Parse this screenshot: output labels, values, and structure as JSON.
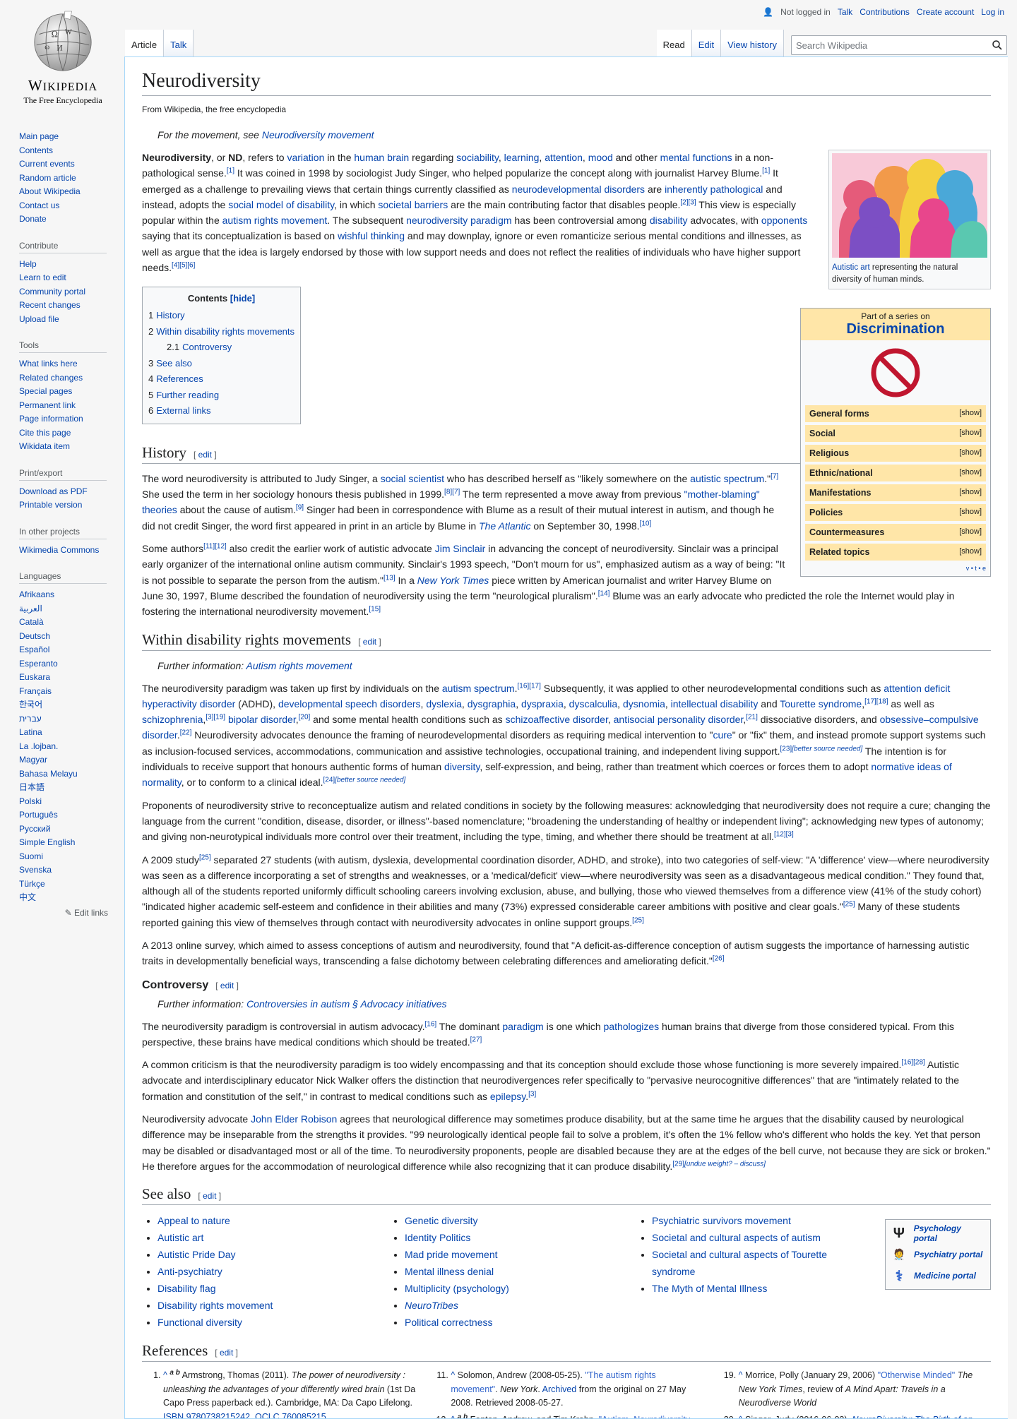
{
  "logo": {
    "wordmark": "Wikipedia",
    "tagline": "The Free Encyclopedia"
  },
  "sidebar": {
    "nav": [
      "Main page",
      "Contents",
      "Current events",
      "Random article",
      "About Wikipedia",
      "Contact us",
      "Donate"
    ],
    "contribute_title": "Contribute",
    "contribute": [
      "Help",
      "Learn to edit",
      "Community portal",
      "Recent changes",
      "Upload file"
    ],
    "tools_title": "Tools",
    "tools": [
      "What links here",
      "Related changes",
      "Special pages",
      "Permanent link",
      "Page information",
      "Cite this page",
      "Wikidata item"
    ],
    "print_title": "Print/export",
    "print": [
      "Download as PDF",
      "Printable version"
    ],
    "projects_title": "In other projects",
    "projects": [
      "Wikimedia Commons"
    ],
    "languages_title": "Languages",
    "languages": [
      "Afrikaans",
      "العربية",
      "Català",
      "Deutsch",
      "Español",
      "Esperanto",
      "Euskara",
      "Français",
      "한국어",
      "עברית",
      "Latina",
      "La .lojban.",
      "Magyar",
      "Bahasa Melayu",
      "日本語",
      "Polski",
      "Português",
      "Русский",
      "Simple English",
      "Suomi",
      "Svenska",
      "Türkçe",
      "中文"
    ],
    "edit_links": "Edit links"
  },
  "personal": {
    "not_logged": "Not logged in",
    "talk": "Talk",
    "contributions": "Contributions",
    "create": "Create account",
    "login": "Log in"
  },
  "tabs": {
    "article": "Article",
    "talk": "Talk",
    "read": "Read",
    "edit": "Edit",
    "history": "View history",
    "search_placeholder": "Search Wikipedia"
  },
  "article": {
    "title": "Neurodiversity",
    "site_sub": "From Wikipedia, the free encyclopedia",
    "hatnote_prefix": "For the movement, see ",
    "hatnote_link": "Neurodiversity movement",
    "thumb_caption_link": "Autistic art",
    "thumb_caption_rest": " representing the natural diversity of human minds.",
    "intro_1": "Neurodiversity",
    "intro_2": ", or ",
    "intro_3": "ND",
    "sidebox": {
      "pretitle": "Part of a series on",
      "title": "Discrimination",
      "rows": [
        "General forms",
        "Social",
        "Religious",
        "Ethnic/national",
        "Manifestations",
        "Policies",
        "Countermeasures",
        "Related topics"
      ],
      "show": "[show]",
      "vte": "v • t • e"
    },
    "toc": {
      "title": "Contents",
      "hide": "[hide]",
      "items": [
        {
          "num": "1",
          "label": "History"
        },
        {
          "num": "2",
          "label": "Within disability rights movements"
        },
        {
          "num": "2.1",
          "label": "Controversy"
        },
        {
          "num": "3",
          "label": "See also"
        },
        {
          "num": "4",
          "label": "References"
        },
        {
          "num": "5",
          "label": "Further reading"
        },
        {
          "num": "6",
          "label": "External links"
        }
      ]
    },
    "h_history": "History",
    "h_within": "Within disability rights movements",
    "within_hatnote_prefix": "Further information: ",
    "within_hatnote_link": "Autism rights movement",
    "h_controversy": "Controversy",
    "controversy_hatnote_link": "Controversies in autism § Advocacy initiatives",
    "h_seealso": "See also",
    "h_references": "References",
    "edit": "edit"
  },
  "see_also": {
    "col1": [
      "Appeal to nature",
      "Autistic art",
      "Autistic Pride Day",
      "Anti-psychiatry",
      "Disability flag",
      "Disability rights movement",
      "Functional diversity"
    ],
    "col2": [
      "Genetic diversity",
      "Identity Politics",
      "Mad pride movement",
      "Mental illness denial",
      "Multiplicity (psychology)",
      "NeuroTribes",
      "Political correctness"
    ],
    "col3": [
      "Psychiatric survivors movement",
      "Societal and cultural aspects of autism",
      "Societal and cultural aspects of Tourette syndrome",
      "The Myth of Mental Illness"
    ],
    "portals": [
      "Psychology portal",
      "Psychiatry portal",
      "Medicine portal"
    ]
  },
  "colors": {
    "link": "#0645ad",
    "border": "#a7d7f9",
    "sidebox": "#ffe6a8"
  }
}
